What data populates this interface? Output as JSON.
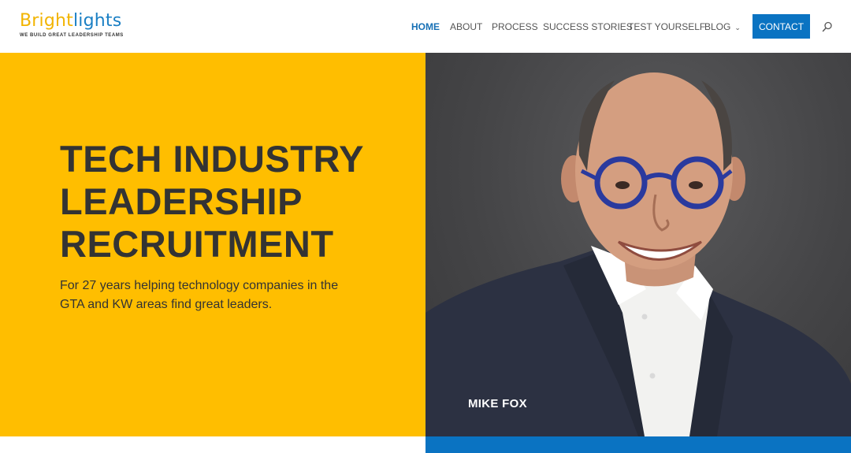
{
  "logo": {
    "word_part1": "Bright",
    "word_part2": "lights",
    "tagline": "WE BUILD GREAT LEADERSHIP TEAMS"
  },
  "nav": {
    "items": [
      {
        "label": "HOME",
        "active": true
      },
      {
        "label": "ABOUT",
        "active": false
      },
      {
        "label": "PROCESS",
        "active": false
      },
      {
        "label": "SUCCESS STORIES",
        "active": false
      },
      {
        "label": "TEST YOURSELF",
        "active": false
      },
      {
        "label": "BLOG",
        "active": false,
        "icon": "chevron-down-icon"
      }
    ],
    "contact_label": "CONTACT",
    "search_icon": "search-icon"
  },
  "hero": {
    "title_lines": [
      "TECH INDUSTRY",
      "LEADERSHIP",
      "RECRUITMENT"
    ],
    "subtitle": "For 27 years helping technology companies in the GTA and KW areas find great leaders.",
    "photo_caption": "MIKE FOX"
  },
  "colors": {
    "brand_yellow": "#ffbe00",
    "brand_blue": "#0a73c2",
    "nav_active": "#1770b5",
    "text_dark": "#333333"
  }
}
